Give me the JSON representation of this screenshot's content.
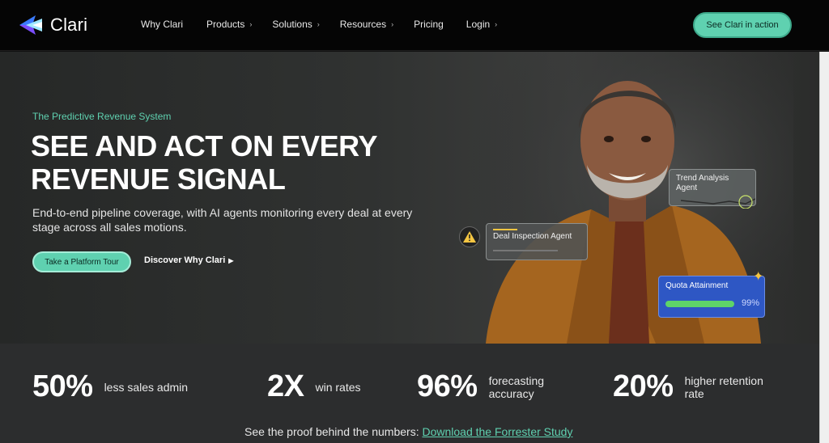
{
  "brand": {
    "name": "Clari",
    "accent": "#5fd1b0"
  },
  "nav": {
    "items": [
      {
        "label": "Why Clari",
        "has_chevron": false
      },
      {
        "label": "Products",
        "has_chevron": true
      },
      {
        "label": "Solutions",
        "has_chevron": true
      },
      {
        "label": "Resources",
        "has_chevron": true
      },
      {
        "label": "Pricing",
        "has_chevron": false
      },
      {
        "label": "Login",
        "has_chevron": true
      }
    ],
    "cta_label": "See Clari in action"
  },
  "hero": {
    "eyebrow": "The Predictive Revenue System",
    "headline": "SEE AND ACT ON EVERY REVENUE SIGNAL",
    "subtext": "End-to-end pipeline coverage, with AI agents monitoring every deal at every stage across all sales motions.",
    "primary_button": "Take a Platform Tour",
    "secondary_button": "Discover Why Clari"
  },
  "cards": {
    "trend": "Trend Analysis Agent",
    "deal": "Deal Inspection Agent",
    "quota_title": "Quota Attainment",
    "quota_value": "99%",
    "quota_fraction": 0.99
  },
  "stats": [
    {
      "number": "50%",
      "label": "less sales admin"
    },
    {
      "number": "2X",
      "label": "win rates"
    },
    {
      "number": "96%",
      "label": "forecasting accuracy"
    },
    {
      "number": "20%",
      "label": "higher retention rate"
    }
  ],
  "proof": {
    "text": "See the proof behind the numbers:",
    "link": "Download the Forrester Study"
  }
}
